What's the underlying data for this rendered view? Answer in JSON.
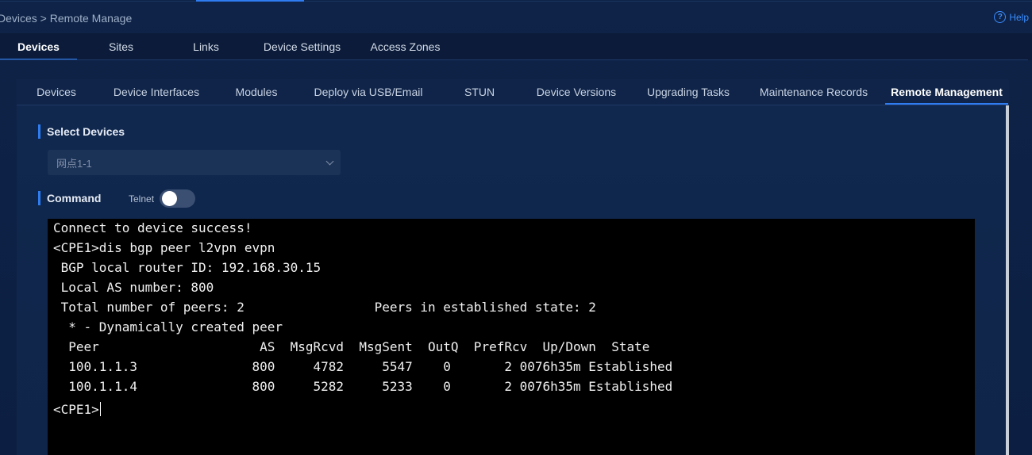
{
  "breadcrumb": "Devices > Remote Manage",
  "help_label": "Help",
  "main_tabs": [
    {
      "label": "Devices",
      "active": true
    },
    {
      "label": "Sites"
    },
    {
      "label": "Links"
    },
    {
      "label": "Device Settings"
    },
    {
      "label": "Access Zones"
    }
  ],
  "sub_tabs": [
    {
      "label": "Devices"
    },
    {
      "label": "Device Interfaces"
    },
    {
      "label": "Modules"
    },
    {
      "label": "Deploy via USB/Email"
    },
    {
      "label": "STUN"
    },
    {
      "label": "Device Versions"
    },
    {
      "label": "Upgrading Tasks"
    },
    {
      "label": "Maintenance Records"
    },
    {
      "label": "Remote Management",
      "active": true
    }
  ],
  "select_devices": {
    "title": "Select Devices",
    "value": "网点1-1"
  },
  "command": {
    "title": "Command",
    "telnet_label": "Telnet",
    "telnet_enabled": false
  },
  "terminal": {
    "lines": [
      "Connect to device success!",
      "<CPE1>dis bgp peer l2vpn evpn",
      " BGP local router ID: 192.168.30.15",
      " Local AS number: 800",
      " Total number of peers: 2                 Peers in established state: 2",
      "  * - Dynamically created peer",
      "  Peer                     AS  MsgRcvd  MsgSent  OutQ  PrefRcv  Up/Down  State",
      "  100.1.1.3               800     4782     5547    0       2 0076h35m Established",
      "  100.1.1.4               800     5282     5233    0       2 0076h35m Established"
    ],
    "prompt": "<CPE1>"
  },
  "colors": {
    "accent": "#2f7bf0",
    "background": "#0d2146",
    "terminal_bg": "#000000"
  }
}
